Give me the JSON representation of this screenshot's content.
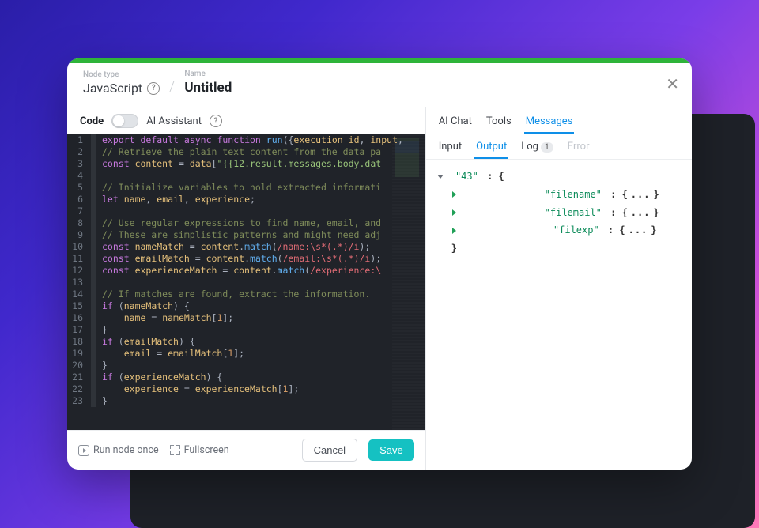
{
  "header": {
    "node_type_label": "Node type",
    "node_type": "JavaScript",
    "name_label": "Name",
    "name": "Untitled"
  },
  "left_toolbar": {
    "code_label": "Code",
    "ai_label": "AI Assistant"
  },
  "code_lines": [
    {
      "n": 1,
      "tokens": [
        [
          "kw",
          "export"
        ],
        [
          "pn",
          " "
        ],
        [
          "kw",
          "default"
        ],
        [
          "pn",
          " "
        ],
        [
          "kw",
          "async"
        ],
        [
          "pn",
          " "
        ],
        [
          "kw",
          "function"
        ],
        [
          "pn",
          " "
        ],
        [
          "fn",
          "run"
        ],
        [
          "pn",
          "({"
        ],
        [
          "id",
          "execution_id"
        ],
        [
          "pn",
          ", "
        ],
        [
          "id",
          "input"
        ],
        [
          "pn",
          ", "
        ]
      ]
    },
    {
      "n": 2,
      "tokens": [
        [
          "cm",
          "// Retrieve the plain text content from the data pa"
        ]
      ]
    },
    {
      "n": 3,
      "tokens": [
        [
          "kw",
          "const"
        ],
        [
          "pn",
          " "
        ],
        [
          "id",
          "content"
        ],
        [
          "pn",
          " = "
        ],
        [
          "id",
          "data"
        ],
        [
          "pn",
          "["
        ],
        [
          "str",
          "\"{{12.result.messages.body.dat"
        ]
      ]
    },
    {
      "n": 4,
      "tokens": []
    },
    {
      "n": 5,
      "tokens": [
        [
          "cm",
          "// Initialize variables to hold extracted informati"
        ]
      ]
    },
    {
      "n": 6,
      "tokens": [
        [
          "kw",
          "let"
        ],
        [
          "pn",
          " "
        ],
        [
          "id",
          "name"
        ],
        [
          "pn",
          ", "
        ],
        [
          "id",
          "email"
        ],
        [
          "pn",
          ", "
        ],
        [
          "id",
          "experience"
        ],
        [
          "pn",
          ";"
        ]
      ]
    },
    {
      "n": 7,
      "tokens": []
    },
    {
      "n": 8,
      "tokens": [
        [
          "cm",
          "// Use regular expressions to find name, email, and"
        ]
      ]
    },
    {
      "n": 9,
      "tokens": [
        [
          "cm",
          "// These are simplistic patterns and might need adj"
        ]
      ]
    },
    {
      "n": 10,
      "tokens": [
        [
          "kw",
          "const"
        ],
        [
          "pn",
          " "
        ],
        [
          "id",
          "nameMatch"
        ],
        [
          "pn",
          " = "
        ],
        [
          "id",
          "content"
        ],
        [
          "pn",
          "."
        ],
        [
          "fn",
          "match"
        ],
        [
          "pn",
          "("
        ],
        [
          "rgx",
          "/name:\\s*(.*)/i"
        ],
        [
          "pn",
          ");"
        ]
      ]
    },
    {
      "n": 11,
      "tokens": [
        [
          "kw",
          "const"
        ],
        [
          "pn",
          " "
        ],
        [
          "id",
          "emailMatch"
        ],
        [
          "pn",
          " = "
        ],
        [
          "id",
          "content"
        ],
        [
          "pn",
          "."
        ],
        [
          "fn",
          "match"
        ],
        [
          "pn",
          "("
        ],
        [
          "rgx",
          "/email:\\s*(.*)/i"
        ],
        [
          "pn",
          ");"
        ]
      ]
    },
    {
      "n": 12,
      "tokens": [
        [
          "kw",
          "const"
        ],
        [
          "pn",
          " "
        ],
        [
          "id",
          "experienceMatch"
        ],
        [
          "pn",
          " = "
        ],
        [
          "id",
          "content"
        ],
        [
          "pn",
          "."
        ],
        [
          "fn",
          "match"
        ],
        [
          "pn",
          "("
        ],
        [
          "rgx",
          "/experience:\\"
        ]
      ]
    },
    {
      "n": 13,
      "tokens": []
    },
    {
      "n": 14,
      "tokens": [
        [
          "cm",
          "// If matches are found, extract the information."
        ]
      ]
    },
    {
      "n": 15,
      "tokens": [
        [
          "kw",
          "if"
        ],
        [
          "pn",
          " ("
        ],
        [
          "id",
          "nameMatch"
        ],
        [
          "pn",
          ") {"
        ]
      ]
    },
    {
      "n": 16,
      "tokens": [
        [
          "pn",
          "    "
        ],
        [
          "id",
          "name"
        ],
        [
          "pn",
          " = "
        ],
        [
          "id",
          "nameMatch"
        ],
        [
          "pn",
          "["
        ],
        [
          "num",
          "1"
        ],
        [
          "pn",
          "];"
        ]
      ]
    },
    {
      "n": 17,
      "tokens": [
        [
          "pn",
          "}"
        ]
      ]
    },
    {
      "n": 18,
      "tokens": [
        [
          "kw",
          "if"
        ],
        [
          "pn",
          " ("
        ],
        [
          "id",
          "emailMatch"
        ],
        [
          "pn",
          ") {"
        ]
      ]
    },
    {
      "n": 19,
      "tokens": [
        [
          "pn",
          "    "
        ],
        [
          "id",
          "email"
        ],
        [
          "pn",
          " = "
        ],
        [
          "id",
          "emailMatch"
        ],
        [
          "pn",
          "["
        ],
        [
          "num",
          "1"
        ],
        [
          "pn",
          "];"
        ]
      ]
    },
    {
      "n": 20,
      "tokens": [
        [
          "pn",
          "}"
        ]
      ]
    },
    {
      "n": 21,
      "tokens": [
        [
          "kw",
          "if"
        ],
        [
          "pn",
          " ("
        ],
        [
          "id",
          "experienceMatch"
        ],
        [
          "pn",
          ") {"
        ]
      ]
    },
    {
      "n": 22,
      "tokens": [
        [
          "pn",
          "    "
        ],
        [
          "id",
          "experience"
        ],
        [
          "pn",
          " = "
        ],
        [
          "id",
          "experienceMatch"
        ],
        [
          "pn",
          "["
        ],
        [
          "num",
          "1"
        ],
        [
          "pn",
          "];"
        ]
      ]
    },
    {
      "n": 23,
      "tokens": [
        [
          "pn",
          "}"
        ]
      ]
    }
  ],
  "footer": {
    "run_once": "Run node once",
    "fullscreen": "Fullscreen",
    "cancel": "Cancel",
    "save": "Save"
  },
  "right_tabs_top": [
    {
      "label": "AI Chat",
      "active": false
    },
    {
      "label": "Tools",
      "active": false
    },
    {
      "label": "Messages",
      "active": true
    }
  ],
  "right_tabs_sub": [
    {
      "label": "Input",
      "active": false,
      "disabled": false
    },
    {
      "label": "Output",
      "active": true,
      "disabled": false
    },
    {
      "label": "Log",
      "active": false,
      "badge": "1"
    },
    {
      "label": "Error",
      "active": false,
      "disabled": true
    }
  ],
  "json_output": {
    "root_key": "43",
    "children": [
      {
        "key": "filename"
      },
      {
        "key": "filemail"
      },
      {
        "key": "filexp"
      }
    ]
  }
}
